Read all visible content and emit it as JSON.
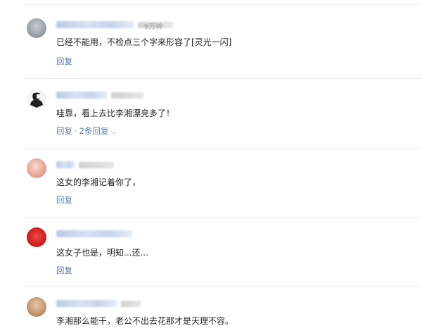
{
  "comments": [
    {
      "meta_visible": "9万神",
      "text": "已经不能用，不检点三个字来形容了[灵光一闪]",
      "actions": {
        "reply_label": "回复"
      }
    },
    {
      "text": "哇靠，看上去比李湘漂亮多了！",
      "actions": {
        "reply_label": "回复",
        "separator": "·",
        "replies_label": "2条回复",
        "expand_icon": "chevron-down-icon"
      }
    },
    {
      "text": "这女的李湘记着你了，",
      "actions": {
        "reply_label": "回复"
      }
    },
    {
      "text": "这女子也是，明知...还...",
      "actions": {
        "reply_label": "回复"
      }
    },
    {
      "text": "李湘那么能干，老公不出去花那才是天理不容。"
    }
  ],
  "colors": {
    "link": "#5b7fb5",
    "text": "#222222",
    "divider": "#ececec"
  }
}
